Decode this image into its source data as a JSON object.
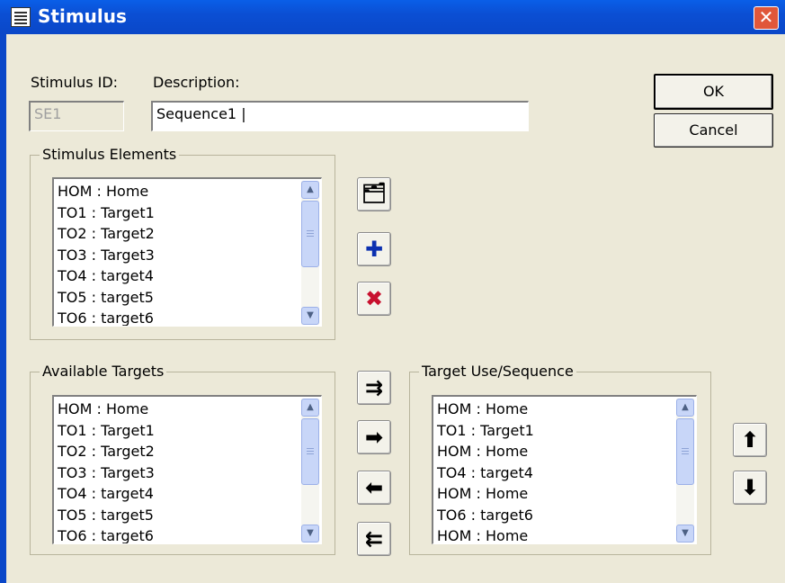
{
  "window": {
    "title": "Stimulus",
    "close_glyph": "✕"
  },
  "form": {
    "stimulus_id_label": "Stimulus ID:",
    "stimulus_id_value": "SE1",
    "description_label": "Description:",
    "description_value": "Sequence1 |"
  },
  "buttons": {
    "ok": "OK",
    "cancel": "Cancel"
  },
  "stimulus_elements": {
    "label": "Stimulus Elements",
    "items": [
      "HOM : Home",
      "TO1 : Target1",
      "TO2 : Target2",
      "TO3 : Target3",
      "TO4 : target4",
      "TO5 : target5",
      "TO6 : target6"
    ],
    "actions": [
      {
        "name": "properties-icon",
        "glyph": "🗂"
      },
      {
        "name": "add-icon",
        "glyph": "✚"
      },
      {
        "name": "delete-icon",
        "glyph": "✖"
      }
    ]
  },
  "available_targets": {
    "label": "Available Targets",
    "items": [
      "HOM : Home",
      "TO1 : Target1",
      "TO2 : Target2",
      "TO3 : Target3",
      "TO4 : target4",
      "TO5 : target5",
      "TO6 : target6"
    ]
  },
  "transfer_buttons": [
    {
      "name": "add-all-icon",
      "glyph": "⇉"
    },
    {
      "name": "add-selected-icon",
      "glyph": "➡"
    },
    {
      "name": "remove-selected-icon",
      "glyph": "⬅"
    },
    {
      "name": "remove-all-icon",
      "glyph": "⇇"
    }
  ],
  "target_sequence": {
    "label": "Target Use/Sequence",
    "items": [
      "HOM : Home",
      "TO1 : Target1",
      "HOM : Home",
      "TO4 : target4",
      "HOM : Home",
      "TO6 : target6",
      "HOM : Home"
    ]
  },
  "order_buttons": [
    {
      "name": "move-up-icon",
      "glyph": "⬆"
    },
    {
      "name": "move-down-icon",
      "glyph": "⬇"
    }
  ],
  "scroll_glyphs": {
    "up": "▲",
    "down": "▼"
  }
}
